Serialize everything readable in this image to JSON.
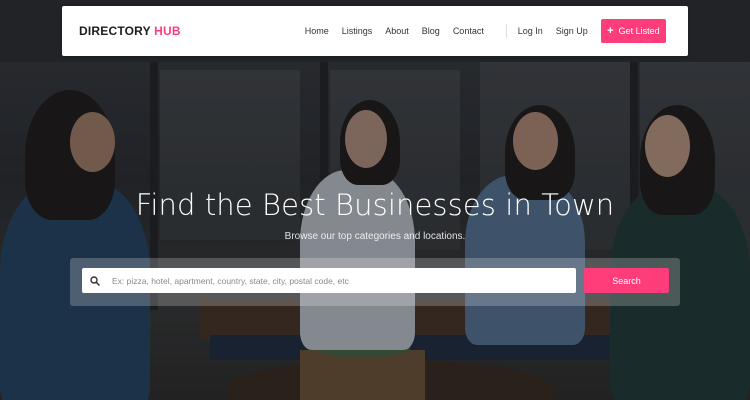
{
  "brand": {
    "name_part1": "DIRECTORY ",
    "name_part2": "HUB",
    "accent_color": "#ff3d7a"
  },
  "nav": {
    "links": [
      "Home",
      "Listings",
      "About",
      "Blog",
      "Contact"
    ],
    "login": "Log In",
    "signup": "Sign Up",
    "cta_label": "Get Listed",
    "cta_icon": "plus-icon"
  },
  "hero": {
    "title": "Find the Best Businesses in Town",
    "subtitle": "Browse our top categories and locations."
  },
  "search": {
    "placeholder": "Ex: pizza, hotel, apartment, country, state, city, postal code, etc",
    "value": "",
    "button_label": "Search",
    "icon": "search-icon"
  }
}
